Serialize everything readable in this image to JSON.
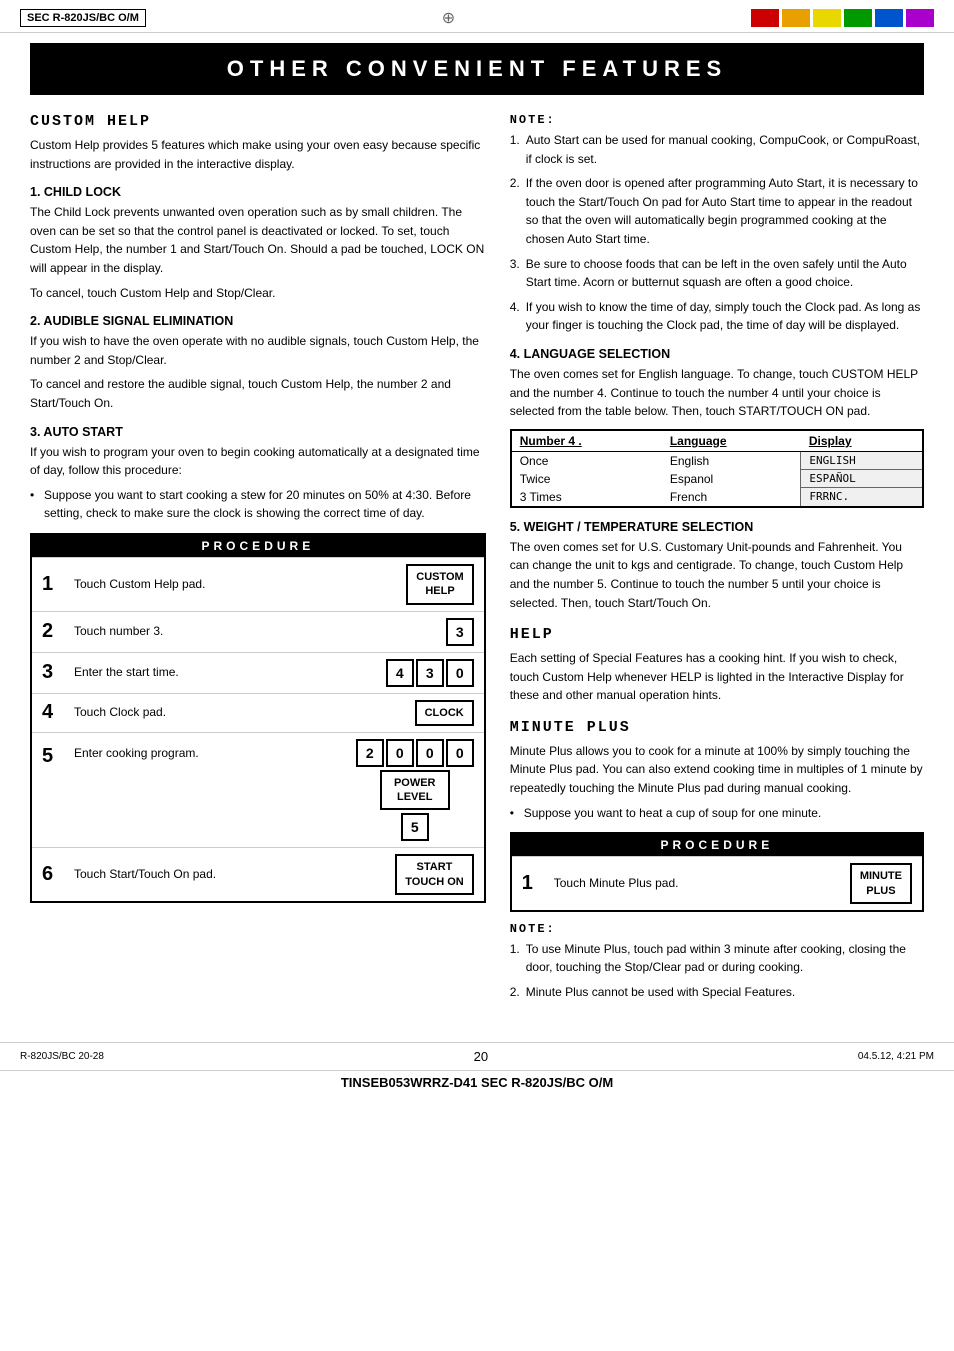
{
  "header": {
    "left_text": "SEC R-820JS/BC O/M",
    "center_symbol": "⊕",
    "colors": [
      "#cc0000",
      "#e8a000",
      "#e8d800",
      "#009900",
      "#0055cc",
      "#aa00cc"
    ]
  },
  "title": "OTHER CONVENIENT FEATURES",
  "sections": {
    "custom_help": {
      "title": "CUSTOM HELP",
      "intro": "Custom Help provides 5 features which make using your oven easy because specific instructions are provided in the interactive display.",
      "child_lock": {
        "title": "1. CHILD LOCK",
        "body": "The Child Lock prevents unwanted oven operation such as by small children. The oven can be set so that the control panel is deactivated or locked. To set, touch Custom Help, the number 1 and Start/Touch On.  Should a pad be touched, LOCK ON will appear in the display.",
        "cancel": "To cancel, touch Custom Help and Stop/Clear."
      },
      "audible_signal": {
        "title": "2. AUDIBLE SIGNAL ELIMINATION",
        "body": "If you wish to have the oven operate with no audible signals, touch Custom Help, the number 2 and Stop/Clear.",
        "cancel": "To cancel and restore the audible signal, touch Custom Help, the number 2 and Start/Touch On."
      },
      "auto_start": {
        "title": "3. AUTO START",
        "intro": "If you wish to program your oven to begin cooking automatically at a designated time of day, follow this procedure:",
        "bullet": "Suppose you want to start cooking a stew for 20 minutes on 50% at 4:30. Before setting, check to make sure the clock is showing the correct time of day."
      }
    },
    "procedure_left": {
      "header": "PROCEDURE",
      "steps": [
        {
          "num": "1",
          "text": "Touch Custom Help pad.",
          "btn_label": "CUSTOM\nHELP",
          "btn_type": "button"
        },
        {
          "num": "2",
          "text": "Touch number 3.",
          "btn_label": "3",
          "btn_type": "box"
        },
        {
          "num": "3",
          "text": "Enter the start time.",
          "boxes": [
            "4",
            "3",
            "0"
          ],
          "btn_type": "boxes"
        },
        {
          "num": "4",
          "text": "Touch Clock pad.",
          "btn_label": "CLOCK",
          "btn_type": "button"
        },
        {
          "num": "5",
          "text": "Enter cooking program.",
          "top_boxes": [
            "2",
            "0",
            "0",
            "0"
          ],
          "mid_btn": "POWER\nLEVEL",
          "bot_box": "5",
          "btn_type": "complex"
        },
        {
          "num": "6",
          "text": "Touch Start/Touch On pad.",
          "btn_label": "START\nTOUCH ON",
          "btn_type": "button"
        }
      ]
    },
    "note_right": {
      "title": "NOTE:",
      "items": [
        "Auto Start can be used for manual cooking, CompuCook, or CompuRoast, if clock is set.",
        "If the oven door is opened after programming Auto Start, it is necessary to touch the Start/Touch On pad for Auto Start time to appear in the readout so that the oven will automatically begin programmed cooking at the chosen Auto Start time.",
        "Be sure to choose foods that can be left in the oven safely until the Auto Start time. Acorn or butternut squash are often a good choice.",
        "If you wish to know the time of day, simply touch the Clock pad. As long as your finger is touching the Clock pad, the time of day will be displayed."
      ]
    },
    "language_selection": {
      "title": "4. LANGUAGE SELECTION",
      "body": "The oven comes set for English language. To change, touch CUSTOM HELP and the number 4. Continue to touch  the number 4 until your choice is selected from the table below. Then, touch START/TOUCH ON pad.",
      "table": {
        "headers": [
          "Number 4 .",
          "Language",
          "Display"
        ],
        "rows": [
          [
            "Once",
            "English",
            "ENGLISH"
          ],
          [
            "Twice",
            "Espanol",
            "ESPAÑOL"
          ],
          [
            "3 Times",
            "French",
            "FRRNC."
          ]
        ]
      }
    },
    "weight_temp": {
      "title": "5. WEIGHT / TEMPERATURE SELECTION",
      "body": "The oven comes set for U.S. Customary Unit-pounds and Fahrenheit. You can change the unit to kgs and centigrade. To change, touch Custom Help and the number 5. Continue to touch the number 5 until your choice is selected. Then, touch Start/Touch On."
    },
    "help": {
      "title": "HELP",
      "body": "Each setting of Special Features has a cooking hint. If you wish to check, touch Custom Help whenever HELP is lighted in the Interactive Display for these and other manual operation hints."
    },
    "minute_plus": {
      "title": "MINUTE PLUS",
      "intro": "Minute Plus allows you to cook for a minute at 100%  by simply touching the Minute Plus pad. You can also extend cooking time in multiples of 1 minute by repeatedly touching the Minute Plus pad during manual cooking.",
      "bullet": "Suppose you want to heat a cup of soup for one minute.",
      "procedure": {
        "header": "PROCEDURE",
        "steps": [
          {
            "num": "1",
            "text": "Touch Minute Plus pad.",
            "btn_label": "MINUTE\nPLUS",
            "btn_type": "button"
          }
        ]
      },
      "note_title": "NOTE:",
      "note_items": [
        "To use Minute Plus, touch pad within 3 minute after cooking, closing the door, touching the Stop/Clear pad or during cooking.",
        "Minute Plus cannot be used with Special Features."
      ]
    }
  },
  "footer": {
    "left": "R-820JS/BC 20-28",
    "center_page": "20",
    "right_date": "04.5.12, 4:21 PM",
    "bottom": "TINSEB053WRRZ-D41 SEC R-820JS/BC O/M"
  }
}
